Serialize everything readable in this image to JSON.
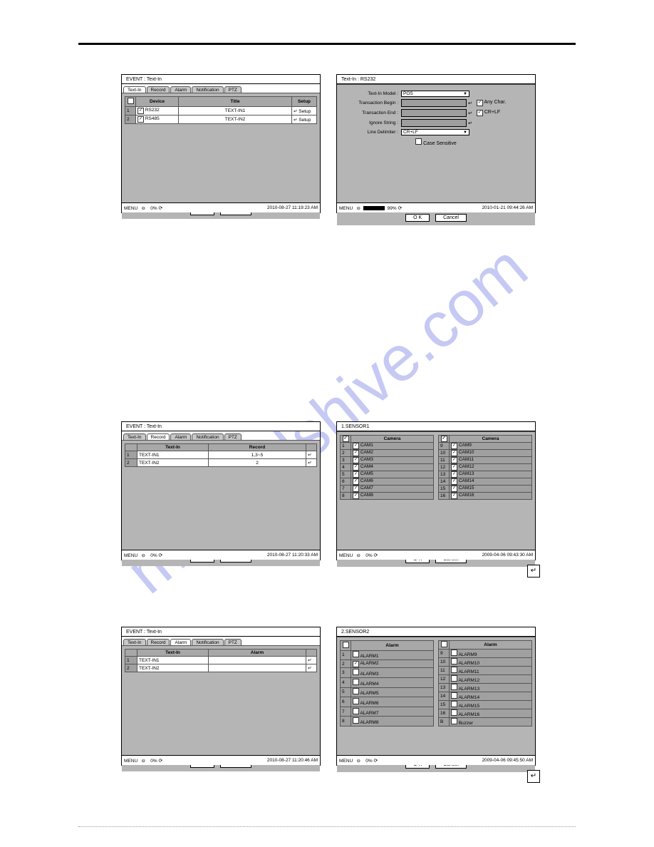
{
  "watermark": "manualshive.com",
  "labels": {
    "ok": "O K",
    "cancel": "Cancel",
    "menu": "MENU"
  },
  "fig1": {
    "title": "EVENT : Text-In",
    "tabs": [
      "Text-In",
      "Record",
      "Alarm",
      "Notification",
      "PTZ"
    ],
    "columns": [
      "Device",
      "Title",
      "Setup"
    ],
    "rows": [
      {
        "device": "RS232",
        "title_col": "TEXT-IN1",
        "setup": "Setup"
      },
      {
        "device": "RS485",
        "title_col": "TEXT-IN2",
        "setup": "Setup"
      }
    ],
    "status": {
      "pct": "0%",
      "time": "2010-08-27 11:19:23 AM"
    }
  },
  "fig2": {
    "title": "Text-In : RS232",
    "fields": {
      "model": {
        "label": "Text-In Model :",
        "value": "POS"
      },
      "tbegin": {
        "label": "Transaction Begin :"
      },
      "tend": {
        "label": "Transaction End :"
      },
      "ignore": {
        "label": "Ignore String :"
      },
      "delim": {
        "label": "Line Delimiter :",
        "value": "CR+LF"
      },
      "anychar": "Any Char.",
      "crlf": "CR+LF",
      "case": "Case Sensitive"
    },
    "status": {
      "pct": "99%",
      "time": "2010-01-21 09:44:26 AM"
    }
  },
  "fig3": {
    "title": "EVENT : Text-In",
    "tabs": [
      "Text-In",
      "Record",
      "Alarm",
      "Notification",
      "PTZ"
    ],
    "columns": [
      "Text-In",
      "Record"
    ],
    "rows": [
      {
        "name": "TEXT-IN1",
        "rec": "1,3~5"
      },
      {
        "name": "TEXT-IN2",
        "rec": "2"
      }
    ],
    "status": {
      "pct": "0%",
      "time": "2010-08-27 11:20:33 AM"
    }
  },
  "fig4": {
    "title": "1.SENSOR1",
    "col": "Camera",
    "left": [
      "CAM1",
      "CAM2",
      "CAM3",
      "CAM4",
      "CAM5",
      "CAM6",
      "CAM7",
      "CAM8"
    ],
    "right": [
      "CAM9",
      "CAM10",
      "CAM11",
      "CAM12",
      "CAM13",
      "CAM14",
      "CAM15",
      "CAM16"
    ],
    "status": {
      "pct": "0%",
      "time": "2009-04-06 09:43:30 AM"
    }
  },
  "fig5": {
    "title": "EVENT : Text-In",
    "tabs": [
      "Text-In",
      "Record",
      "Alarm",
      "Notification",
      "PTZ"
    ],
    "columns": [
      "Text-In",
      "Alarm"
    ],
    "rows": [
      {
        "name": "TEXT-IN1"
      },
      {
        "name": "TEXT-IN2"
      }
    ],
    "status": {
      "pct": "0%",
      "time": "2010-08-27 11:20:46 AM"
    }
  },
  "fig6": {
    "title": "2.SENSOR2",
    "col": "Alarm",
    "left": [
      "ALARM1",
      "ALARM2",
      "ALARM3",
      "ALARM4",
      "ALARM5",
      "ALARM6",
      "ALARM7",
      "ALARM8"
    ],
    "right": [
      "ALARM9",
      "ALARM10",
      "ALARM11",
      "ALARM12",
      "ALARM13",
      "ALARM14",
      "ALARM15",
      "ALARM16"
    ],
    "buzzer": "Buzzer",
    "status": {
      "pct": "0%",
      "time": "2009-04-06 09:45:50 AM"
    }
  }
}
